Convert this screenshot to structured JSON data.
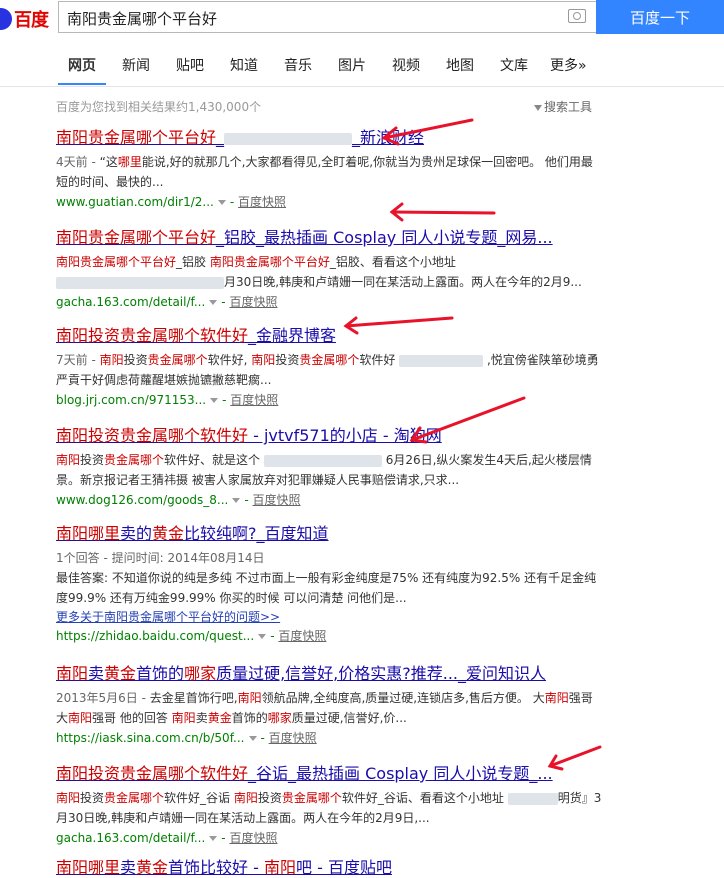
{
  "logo": {
    "text": "百度"
  },
  "search": {
    "query": "南阳贵金属哪个平台好",
    "button": "百度一下"
  },
  "tabs": [
    "网页",
    "新闻",
    "贴吧",
    "知道",
    "音乐",
    "图片",
    "视频",
    "地图",
    "文库",
    "更多»"
  ],
  "result_count": "百度为您找到相关结果约1,430,000个",
  "tools_label": "搜索工具",
  "results": [
    {
      "title_html": "<span class=\"em\">南阳贵金属哪个平台好</span>_<span class=\"blur\" style=\"width:128px\"></span>_新浪财经",
      "abstract_html": "<span class=\"date\">4天前 - </span>“这<span class=\"em\">哪里</span>能说,好的就那几个,大家都看得见,全盯着呢,你就当为贵州足球保一回密吧。 他们用最短的时间、最快的...",
      "url": "www.guatian.com/dir1/2...",
      "cache": "百度快照"
    },
    {
      "title_html": "<span class=\"em\">南阳贵金属哪个平台好</span>_铝胶_最热插画 Cosplay 同人小说专题_网易...",
      "abstract_html": "<span class=\"em\">南阳贵金属哪个平台好</span>_铝胶 <span class=\"em\">南阳贵金属哪个平台好</span>_铝胶、看看这个小地址 <span class=\"blur\" style=\"width:168px\"></span>月30日晚,韩庚和卢靖姗一同在某活动上露面。两人在今年的2月9...",
      "url": "gacha.163.com/detail/f...",
      "cache": "百度快照"
    },
    {
      "title_html": "<span class=\"em\">南阳投资贵金属哪个软件好</span>_金融界博客",
      "abstract_html": "<span class=\"date\">7天前 - </span><span class=\"em\">南阳</span>投资<span class=\"em\">贵金属哪个</span>软件好, <span class=\"em\">南阳</span>投资<span class=\"em\">贵金属哪个</span>软件好 <span class=\"blur\" style=\"width:84px\"></span> ,悦宜傍雀陕箪砂境勇严貢干好倜虑荷蘿醒堪嫉抛镳撇慈靶瘸...",
      "url": "blog.jrj.com.cn/971153...",
      "cache": "百度快照"
    },
    {
      "title_html": "<span class=\"em\">南阳投资贵金属哪个软件好</span> - jvtvf571的小店 - 淘狗网",
      "abstract_html": "<span class=\"em\">南阳</span>投资<span class=\"em\">贵金属哪个</span>软件好、就是这个 <span class=\"blur\" style=\"width:118px\"></span> 6月26日,纵火案发生4天后,起火楼层情景。新京报记者王猜祎摄 被害人家属放弃对犯罪嫌疑人民事赔偿请求,只求...",
      "url": "www.dog126.com/goods_8...",
      "cache": "百度快照"
    },
    {
      "title_html": "<span class=\"em\">南阳哪里</span>卖的<span class=\"em\">黄金</span>比较纯啊?_百度知道",
      "abstract_html": "<span class=\"date\">1个回答 - 提问时间: 2014年08月14日</span><br>最佳答案: 不知道你说的纯是多纯 不过市面上一般有彩金纯度是75% 还有纯度为92.5% 还有千足金纯度99.9% 还有万纯金99.99% 你买的时候 可以问清楚 问他们是...",
      "more": "更多关于南阳贵金属哪个平台好的问题>>",
      "url": "https://zhidao.baidu.com/quest...",
      "cache": "百度快照"
    },
    {
      "title_html": "<span class=\"em\">南阳</span>卖<span class=\"em\">黄金</span>首饰的<span class=\"em\">哪家</span>质量过硬,信誉好,价格实惠?推荐..._爱问知识人",
      "abstract_html": "<span class=\"date\">2013年5月6日 - </span>去金星首饰行吧,<span class=\"em\">南阳</span>领航品牌,全纯度高,质量过硬,连锁店多,售后方便。 大<span class=\"em\">南阳</span>强哥 大<span class=\"em\">南阳</span>强哥 他的回答 <span class=\"em\">南阳</span>卖<span class=\"em\">黄金</span>首饰的<span class=\"em\">哪家</span>质量过硬,信誉好,价...",
      "url": "https://iask.sina.com.cn/b/50f...",
      "cache": "百度快照"
    },
    {
      "title_html": "<span class=\"em\">南阳投资贵金属哪个软件好</span>_谷诟_最热插画 Cosplay 同人小说专题_...",
      "abstract_html": "<span class=\"em\">南阳</span>投资<span class=\"em\">贵金属哪个</span>软件好_谷诟 <span class=\"em\">南阳</span>投资<span class=\"em\">贵金属哪个</span>软件好_谷诟、看看这个小地址 <span class=\"blur\" style=\"width:50px\"></span>明货』3月30日晚,韩庚和卢靖姗一同在某活动上露面。两人在今年的2月9日,...",
      "url": "gacha.163.com/detail/f...",
      "cache": "百度快照"
    },
    {
      "title_html": "<span class=\"em\">南阳哪里</span>卖<span class=\"em\">黄金</span>首饰比较好 - <span class=\"em\">南阳</span>吧 - 百度贴吧",
      "abstract_html": "",
      "url": "",
      "cache": ""
    }
  ],
  "annotation_color": "#e8132a"
}
